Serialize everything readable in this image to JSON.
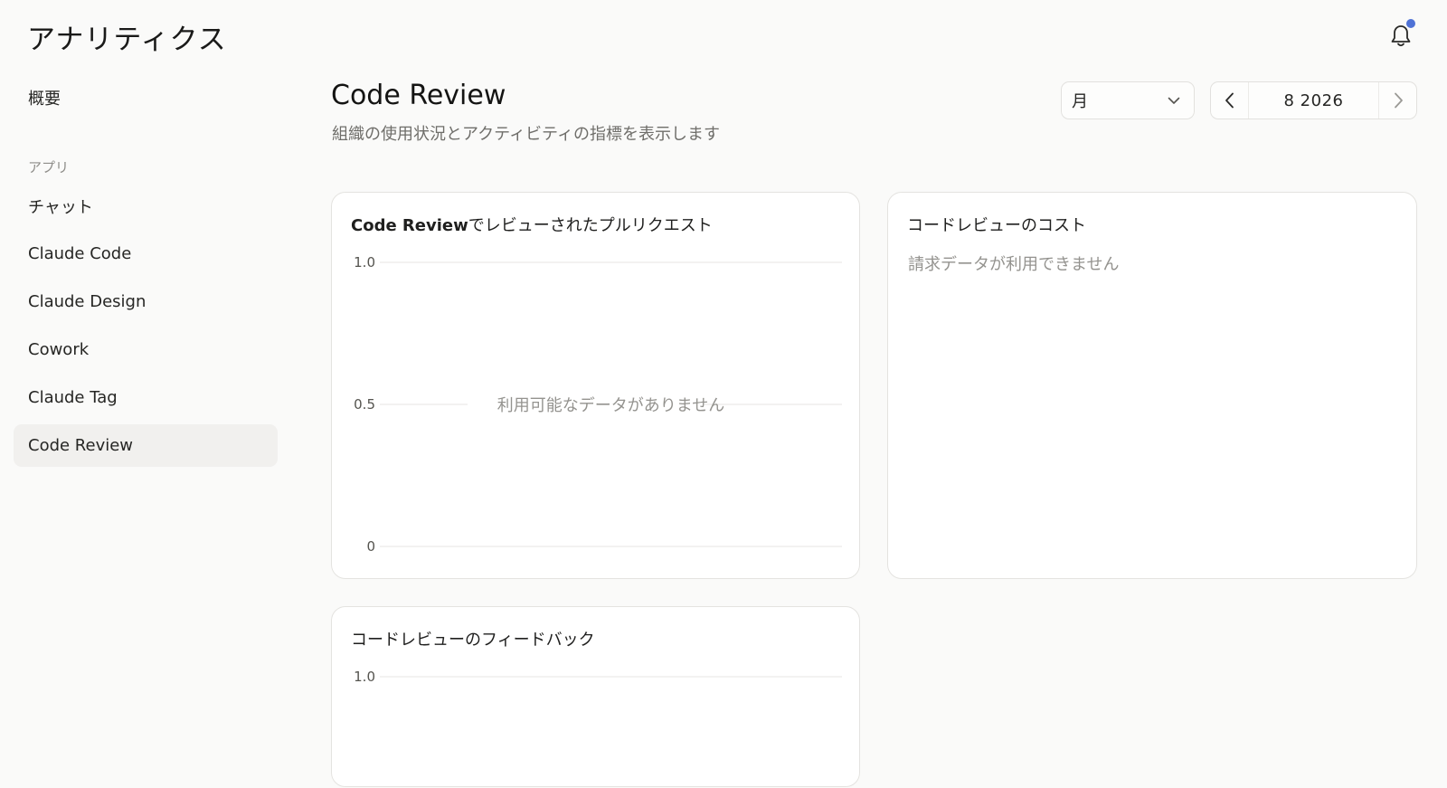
{
  "app": {
    "title": "アナリティクス"
  },
  "header": {
    "notification_icon": "bell-icon",
    "accent": "#4f72d6"
  },
  "sidebar": {
    "overview": "概要",
    "section_label": "アプリ",
    "items": [
      {
        "label": "チャット"
      },
      {
        "label": "Claude Code"
      },
      {
        "label": "Claude Design"
      },
      {
        "label": "Cowork"
      },
      {
        "label": "Claude Tag"
      },
      {
        "label": "Code Review",
        "active": true
      }
    ]
  },
  "main": {
    "title": "Code Review",
    "subtitle": "組織の使用状況とアクティビティの指標を表示します",
    "period_select": {
      "value": "月"
    },
    "date_nav": {
      "label": "8 2026"
    }
  },
  "cards": {
    "prs": {
      "title_bold": "Code Review",
      "title_rest": "でレビューされたプルリクエスト",
      "empty": "利用可能なデータがありません"
    },
    "cost": {
      "title": "コードレビューのコスト",
      "empty": "請求データが利用できません"
    },
    "feedback": {
      "title": "コードレビューのフィードバック"
    }
  },
  "chart_data": [
    {
      "type": "line",
      "title": "Code Reviewでレビューされたプルリクエスト",
      "y_ticks": [
        "1.0",
        "0.5",
        "0"
      ],
      "ylim": [
        0,
        1
      ],
      "series": [],
      "annotation": "利用可能なデータがありません"
    },
    {
      "type": "line",
      "title": "コードレビューのフィードバック",
      "y_ticks": [
        "1.0"
      ],
      "ylim": [
        0,
        1
      ],
      "series": []
    }
  ]
}
